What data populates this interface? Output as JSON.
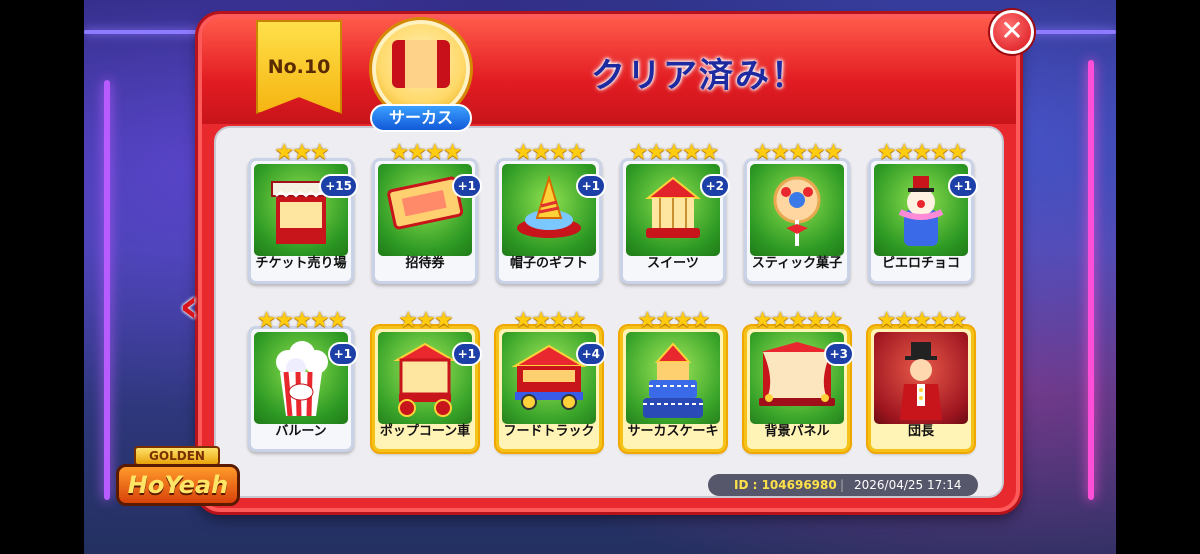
{
  "header": {
    "title": "クリア済み！",
    "rank": "No.10",
    "theme": "サーカス"
  },
  "nav": {
    "close": "✕",
    "prev": "‹"
  },
  "colors": {
    "panel_red": "#e8292e",
    "title_blue": "#1e2aa0",
    "badge_blue": "#1d3fa8",
    "star_gold": "#ffcc10"
  },
  "cards": [
    {
      "label": "チケット売り場",
      "stars": "★★★",
      "count": "+15",
      "tier": "normal",
      "art": "ticket-booth"
    },
    {
      "label": "招待券",
      "stars": "★★★★",
      "count": "+1",
      "tier": "normal",
      "art": "ticket"
    },
    {
      "label": "帽子のギフト",
      "stars": "★★★★",
      "count": "+1",
      "tier": "normal",
      "art": "hat"
    },
    {
      "label": "スイーツ",
      "stars": "★★★★★",
      "count": "+2",
      "tier": "normal",
      "art": "carousel"
    },
    {
      "label": "スティック菓子",
      "stars": "★★★★★",
      "count": "",
      "tier": "normal",
      "art": "lollipop"
    },
    {
      "label": "ピエロチョコ",
      "stars": "★★★★★",
      "count": "+1",
      "tier": "normal",
      "art": "clown"
    },
    {
      "label": "バルーン",
      "stars": "★★★★★",
      "count": "+1",
      "tier": "normal",
      "art": "popcorn"
    },
    {
      "label": "ポップコーン車",
      "stars": "★★★",
      "count": "+1",
      "tier": "gold",
      "art": "popcorn-cart"
    },
    {
      "label": "フードトラック",
      "stars": "★★★★",
      "count": "+4",
      "tier": "gold",
      "art": "food-truck"
    },
    {
      "label": "サーカスケーキ",
      "stars": "★★★★",
      "count": "",
      "tier": "gold",
      "art": "cake"
    },
    {
      "label": "背景パネル",
      "stars": "★★★★★",
      "count": "+3",
      "tier": "gold",
      "art": "stage"
    },
    {
      "label": "団長",
      "stars": "★★★★★",
      "count": "",
      "tier": "gold",
      "art": "ringmaster"
    }
  ],
  "footer": {
    "id_text": "ID : 104696980",
    "separator": "|",
    "date_text": "2026/04/25 17:14"
  },
  "logo": {
    "top": "GOLDEN",
    "main": "HoYeah"
  }
}
